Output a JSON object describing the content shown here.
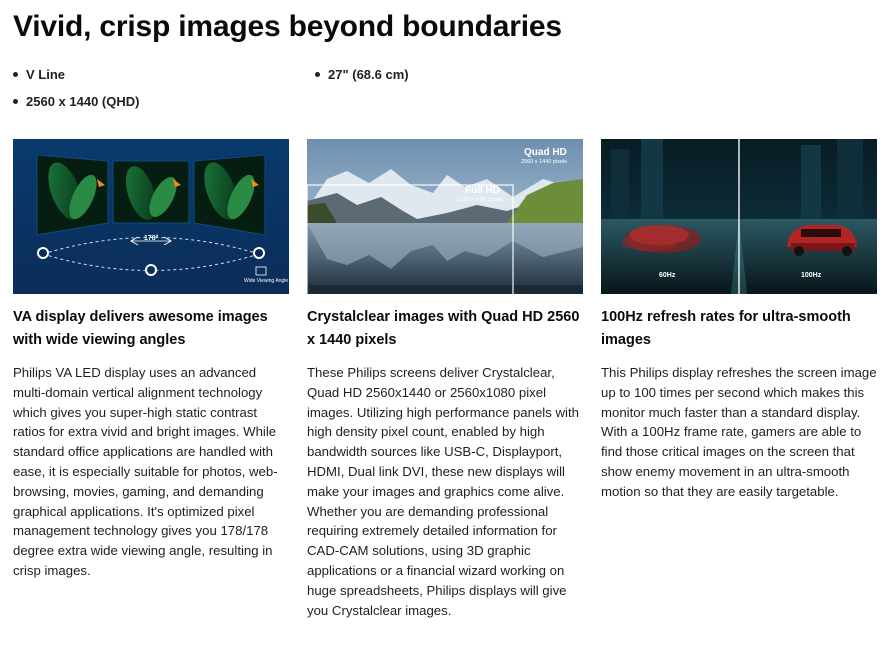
{
  "page": {
    "title": "Vivid, crisp images beyond boundaries"
  },
  "specs": [
    {
      "label": "V Line"
    },
    {
      "label": "27\" (68.6 cm)"
    },
    {
      "label": "2560 x 1440 (QHD)"
    }
  ],
  "features": [
    {
      "title": "VA display delivers awesome images with wide viewing angles",
      "body": "Philips VA LED display uses an advanced multi-domain vertical alignment technology which gives you super-high static contrast ratios for extra vivid and bright images. While standard office applications are handled with ease, it is especially suitable for photos, web-browsing, movies, gaming, and demanding graphical applications. It's optimized pixel management technology gives you 178/178 degree extra wide viewing angle, resulting in crisp images.",
      "image": {
        "angle_label": "178°",
        "logo_caption": "Wide Viewing Angle"
      }
    },
    {
      "title": "Crystalclear images with Quad HD 2560 x 1440 pixels",
      "body": "These Philips screens deliver Crystalclear, Quad HD 2560x1440 or 2560x1080 pixel images. Utilizing high performance panels with high density pixel count, enabled by high bandwidth sources like USB-C, Displayport, HDMI, Dual link DVI, these new displays will make your images and graphics come alive. Whether you are demanding professional requiring extremely detailed information for CAD-CAM solutions, using 3D graphic applications or a financial wizard working on huge spreadsheets, Philips displays will give you Crystalclear images.",
      "image": {
        "qhd_label": "Quad HD",
        "qhd_res": "2560 x 1440 pixels",
        "fhd_label": "Full HD",
        "fhd_res": "1920 x 1080 pixels"
      }
    },
    {
      "title": "100Hz refresh rates for ultra-smooth images",
      "body": "This Philips display refreshes the screen image up to 100 times per second which makes this monitor much faster than a standard display. With a 100Hz frame rate, gamers are able to find those critical images on the screen that show enemy movement in an ultra-smooth motion so that they are easily targetable.",
      "image": {
        "left_label": "60Hz",
        "right_label": "100Hz"
      }
    }
  ]
}
